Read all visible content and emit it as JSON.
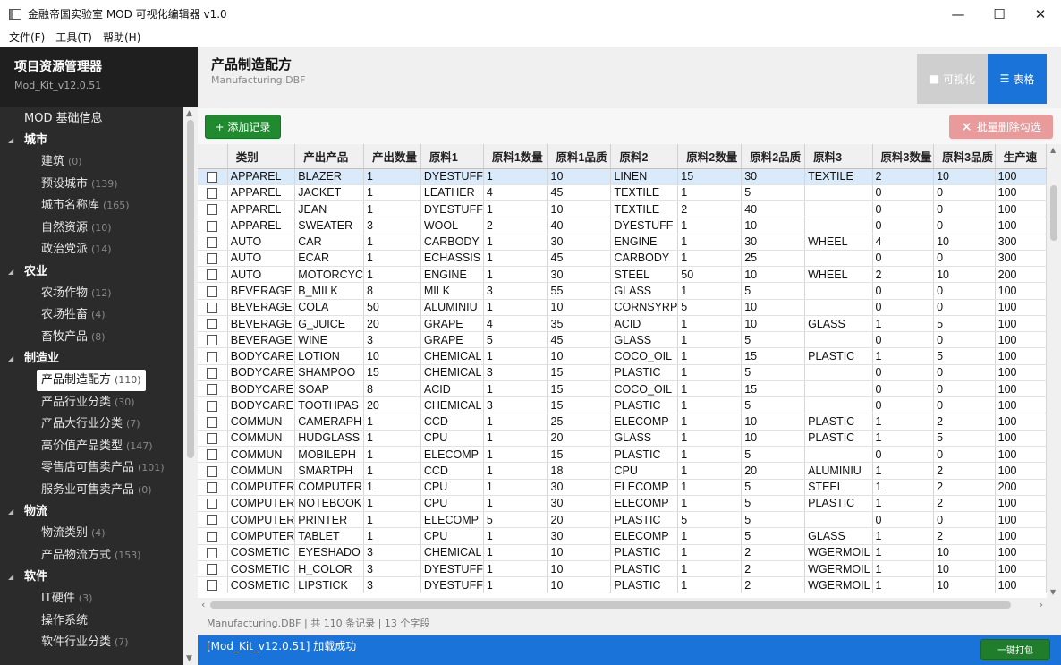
{
  "window": {
    "title": "金融帝国实验室 MOD 可视化编辑器 v1.0",
    "minimize": "—",
    "maximize": "☐",
    "close": "✕"
  },
  "menu": [
    "文件(F)",
    "工具(T)",
    "帮助(H)"
  ],
  "sidebar": {
    "title": "项目资源管理器",
    "subtitle": "Mod_Kit_v12.0.51",
    "root": "MOD 基础信息",
    "groups": [
      {
        "label": "城市",
        "items": [
          {
            "label": "建筑",
            "count": "(0)"
          },
          {
            "label": "预设城市",
            "count": "(139)"
          },
          {
            "label": "城市名称库",
            "count": "(165)"
          },
          {
            "label": "自然资源",
            "count": "(10)"
          },
          {
            "label": "政治党派",
            "count": "(14)"
          }
        ]
      },
      {
        "label": "农业",
        "items": [
          {
            "label": "农场作物",
            "count": "(12)"
          },
          {
            "label": "农场牲畜",
            "count": "(4)"
          },
          {
            "label": "畜牧产品",
            "count": "(8)"
          }
        ]
      },
      {
        "label": "制造业",
        "items": [
          {
            "label": "产品制造配方",
            "count": "(110)",
            "active": true
          },
          {
            "label": "产品行业分类",
            "count": "(30)"
          },
          {
            "label": "产品大行业分类",
            "count": "(7)"
          },
          {
            "label": "高价值产品类型",
            "count": "(147)"
          },
          {
            "label": "零售店可售卖产品",
            "count": "(101)"
          },
          {
            "label": "服务业可售卖产品",
            "count": "(0)"
          }
        ]
      },
      {
        "label": "物流",
        "items": [
          {
            "label": "物流类别",
            "count": "(4)"
          },
          {
            "label": "产品物流方式",
            "count": "(153)"
          }
        ]
      },
      {
        "label": "软件",
        "items": [
          {
            "label": "IT硬件",
            "count": "(3)"
          },
          {
            "label": "操作系统",
            "count": ""
          },
          {
            "label": "软件行业分类",
            "count": "(7)"
          }
        ]
      }
    ]
  },
  "header": {
    "title": "产品制造配方",
    "subtitle": "Manufacturing.DBF",
    "view_visual": "可视化",
    "view_table": "表格"
  },
  "toolbar": {
    "add_label": "+ 添加记录",
    "delete_label": "批量删除勾选"
  },
  "table": {
    "columns": [
      "类别",
      "产出产品",
      "产出数量",
      "原料1",
      "原料1数量",
      "原料1品质",
      "原料2",
      "原料2数量",
      "原料2品质",
      "原料3",
      "原料3数量",
      "原料3品质",
      "生产速"
    ],
    "rows": [
      [
        "APPAREL",
        "BLAZER",
        "1",
        "DYESTUFF",
        "1",
        "10",
        "LINEN",
        "15",
        "30",
        "TEXTILE",
        "2",
        "10",
        "100"
      ],
      [
        "APPAREL",
        "JACKET",
        "1",
        "LEATHER",
        "4",
        "45",
        "TEXTILE",
        "1",
        "5",
        "",
        "0",
        "0",
        "100"
      ],
      [
        "APPAREL",
        "JEAN",
        "1",
        "DYESTUFF",
        "1",
        "10",
        "TEXTILE",
        "2",
        "40",
        "",
        "0",
        "0",
        "100"
      ],
      [
        "APPAREL",
        "SWEATER",
        "3",
        "WOOL",
        "2",
        "40",
        "DYESTUFF",
        "1",
        "10",
        "",
        "0",
        "0",
        "100"
      ],
      [
        "AUTO",
        "CAR",
        "1",
        "CARBODY",
        "1",
        "30",
        "ENGINE",
        "1",
        "30",
        "WHEEL",
        "4",
        "10",
        "300"
      ],
      [
        "AUTO",
        "ECAR",
        "1",
        "ECHASSIS",
        "1",
        "45",
        "CARBODY",
        "1",
        "25",
        "",
        "0",
        "0",
        "300"
      ],
      [
        "AUTO",
        "MOTORCYC",
        "1",
        "ENGINE",
        "1",
        "30",
        "STEEL",
        "50",
        "10",
        "WHEEL",
        "2",
        "10",
        "200"
      ],
      [
        "BEVERAGE",
        "B_MILK",
        "8",
        "MILK",
        "3",
        "55",
        "GLASS",
        "1",
        "5",
        "",
        "0",
        "0",
        "100"
      ],
      [
        "BEVERAGE",
        "COLA",
        "50",
        "ALUMINIU",
        "1",
        "10",
        "CORNSYRP",
        "5",
        "10",
        "",
        "0",
        "0",
        "100"
      ],
      [
        "BEVERAGE",
        "G_JUICE",
        "20",
        "GRAPE",
        "4",
        "35",
        "ACID",
        "1",
        "10",
        "GLASS",
        "1",
        "5",
        "100"
      ],
      [
        "BEVERAGE",
        "WINE",
        "3",
        "GRAPE",
        "5",
        "45",
        "GLASS",
        "1",
        "5",
        "",
        "0",
        "0",
        "100"
      ],
      [
        "BODYCARE",
        "LOTION",
        "10",
        "CHEMICAL",
        "1",
        "10",
        "COCO_OIL",
        "1",
        "15",
        "PLASTIC",
        "1",
        "5",
        "100"
      ],
      [
        "BODYCARE",
        "SHAMPOO",
        "15",
        "CHEMICAL",
        "3",
        "15",
        "PLASTIC",
        "1",
        "5",
        "",
        "0",
        "0",
        "100"
      ],
      [
        "BODYCARE",
        "SOAP",
        "8",
        "ACID",
        "1",
        "15",
        "COCO_OIL",
        "1",
        "15",
        "",
        "0",
        "0",
        "100"
      ],
      [
        "BODYCARE",
        "TOOTHPAS",
        "20",
        "CHEMICAL",
        "3",
        "15",
        "PLASTIC",
        "1",
        "5",
        "",
        "0",
        "0",
        "100"
      ],
      [
        "COMMUN",
        "CAMERAPH",
        "1",
        "CCD",
        "1",
        "25",
        "ELECOMP",
        "1",
        "10",
        "PLASTIC",
        "1",
        "2",
        "100"
      ],
      [
        "COMMUN",
        "HUDGLASS",
        "1",
        "CPU",
        "1",
        "20",
        "GLASS",
        "1",
        "10",
        "PLASTIC",
        "1",
        "5",
        "100"
      ],
      [
        "COMMUN",
        "MOBILEPH",
        "1",
        "ELECOMP",
        "1",
        "15",
        "PLASTIC",
        "1",
        "5",
        "",
        "0",
        "0",
        "100"
      ],
      [
        "COMMUN",
        "SMARTPH",
        "1",
        "CCD",
        "1",
        "18",
        "CPU",
        "1",
        "20",
        "ALUMINIU",
        "1",
        "2",
        "100"
      ],
      [
        "COMPUTER",
        "COMPUTER",
        "1",
        "CPU",
        "1",
        "30",
        "ELECOMP",
        "1",
        "5",
        "STEEL",
        "1",
        "2",
        "200"
      ],
      [
        "COMPUTER",
        "NOTEBOOK",
        "1",
        "CPU",
        "1",
        "30",
        "ELECOMP",
        "1",
        "5",
        "PLASTIC",
        "1",
        "2",
        "100"
      ],
      [
        "COMPUTER",
        "PRINTER",
        "1",
        "ELECOMP",
        "5",
        "20",
        "PLASTIC",
        "5",
        "5",
        "",
        "0",
        "0",
        "100"
      ],
      [
        "COMPUTER",
        "TABLET",
        "1",
        "CPU",
        "1",
        "30",
        "ELECOMP",
        "1",
        "5",
        "GLASS",
        "1",
        "2",
        "100"
      ],
      [
        "COSMETIC",
        "EYESHADO",
        "3",
        "CHEMICAL",
        "1",
        "10",
        "PLASTIC",
        "1",
        "2",
        "WGERMOIL",
        "1",
        "10",
        "100"
      ],
      [
        "COSMETIC",
        "H_COLOR",
        "3",
        "DYESTUFF",
        "1",
        "10",
        "PLASTIC",
        "1",
        "2",
        "WGERMOIL",
        "1",
        "10",
        "100"
      ],
      [
        "COSMETIC",
        "LIPSTICK",
        "3",
        "DYESTUFF",
        "1",
        "10",
        "PLASTIC",
        "1",
        "2",
        "WGERMOIL",
        "1",
        "10",
        "100"
      ]
    ]
  },
  "status": {
    "info": "Manufacturing.DBF | 共 110 条记录 | 13 个字段",
    "message": "[Mod_Kit_v12.0.51] 加载成功",
    "pack_label": "一键打包"
  },
  "colors": {
    "accent_blue": "#1a73d9",
    "add_green": "#1f8a2e",
    "delete_red": "#e99a9a",
    "sidebar_bg": "#2b2b2b",
    "selected_row": "#d9ebfb"
  }
}
